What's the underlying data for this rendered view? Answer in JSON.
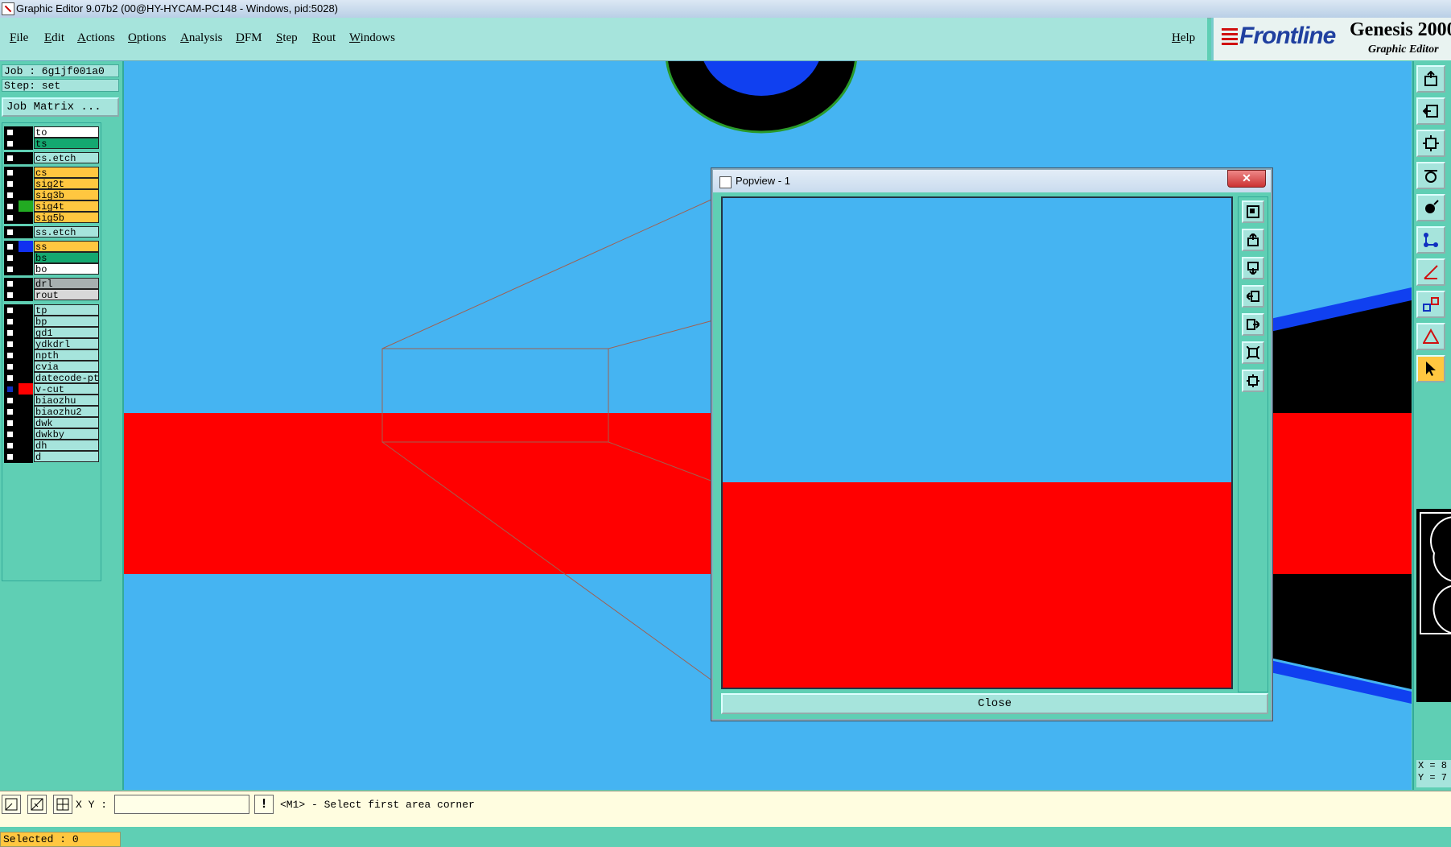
{
  "window": {
    "title": "Graphic Editor 9.07b2 (00@HY-HYCAM-PC148 - Windows, pid:5028)"
  },
  "menu": {
    "items": [
      "File",
      "Edit",
      "Actions",
      "Options",
      "Analysis",
      "DFM",
      "Step",
      "Rout",
      "Windows"
    ],
    "help": "Help"
  },
  "brand": {
    "logo": "Frontline",
    "product": "Genesis 2000",
    "subtitle": "Graphic Editor"
  },
  "info": {
    "job": "Job : 6g1jf001a0",
    "step": "Step: set",
    "job_matrix": "Job Matrix ..."
  },
  "layers": [
    {
      "name": "to",
      "color": "#ffffff",
      "swatch": "#000000",
      "checked": false
    },
    {
      "name": "ts",
      "color": "#14a870",
      "swatch": "#000000",
      "checked": false
    },
    {
      "name": "cs.etch",
      "color": "#a6e4dc",
      "swatch": "#000000",
      "checked": false
    },
    {
      "name": "cs",
      "color": "#ffc740",
      "swatch": "#000000",
      "checked": false
    },
    {
      "name": "sig2t",
      "color": "#ffc740",
      "swatch": "#000000",
      "checked": false
    },
    {
      "name": "sig3b",
      "color": "#ffc740",
      "swatch": "#000000",
      "checked": false
    },
    {
      "name": "sig4t",
      "color": "#ffc740",
      "swatch": "#22aa22",
      "checked": false
    },
    {
      "name": "sig5b",
      "color": "#ffc740",
      "swatch": "#000000",
      "checked": false
    },
    {
      "name": "ss.etch",
      "color": "#a6e4dc",
      "swatch": "#000000",
      "checked": false
    },
    {
      "name": "ss",
      "color": "#ffc740",
      "swatch": "#1030f0",
      "checked": false
    },
    {
      "name": "bs",
      "color": "#14a870",
      "swatch": "#000000",
      "checked": false
    },
    {
      "name": "bo",
      "color": "#ffffff",
      "swatch": "#000000",
      "checked": false
    },
    {
      "name": "drl",
      "color": "#a8b0b0",
      "swatch": "#000000",
      "checked": false
    },
    {
      "name": "rout",
      "color": "#d8d8d8",
      "swatch": "#000000",
      "checked": false
    },
    {
      "name": "tp",
      "color": "#a6e4dc",
      "swatch": "#000000",
      "checked": false
    },
    {
      "name": "bp",
      "color": "#a6e4dc",
      "swatch": "#000000",
      "checked": false
    },
    {
      "name": "gd1",
      "color": "#a6e4dc",
      "swatch": "#000000",
      "checked": false
    },
    {
      "name": "ydkdrl",
      "color": "#a6e4dc",
      "swatch": "#000000",
      "checked": false
    },
    {
      "name": "npth",
      "color": "#a6e4dc",
      "swatch": "#000000",
      "checked": false
    },
    {
      "name": "cvia",
      "color": "#a6e4dc",
      "swatch": "#000000",
      "checked": false
    },
    {
      "name": "datecode-pt",
      "color": "#a6e4dc",
      "swatch": "#000000",
      "checked": false
    },
    {
      "name": "v-cut",
      "color": "#a6e4dc",
      "swatch": "#ff0000",
      "checked": true
    },
    {
      "name": "biaozhu",
      "color": "#a6e4dc",
      "swatch": "#000000",
      "checked": false
    },
    {
      "name": "biaozhu2",
      "color": "#a6e4dc",
      "swatch": "#000000",
      "checked": false
    },
    {
      "name": "dwk",
      "color": "#a6e4dc",
      "swatch": "#000000",
      "checked": false
    },
    {
      "name": "dwkby",
      "color": "#a6e4dc",
      "swatch": "#000000",
      "checked": false
    },
    {
      "name": "dh",
      "color": "#a6e4dc",
      "swatch": "#000000",
      "checked": false
    },
    {
      "name": "d",
      "color": "#a6e4dc",
      "swatch": "#000000",
      "checked": false
    }
  ],
  "selected": "Selected : 0",
  "popview": {
    "title": "Popview - 1",
    "close_x": "✕",
    "close_label": "Close"
  },
  "status": {
    "xy_label": "X Y :",
    "xy_value": "",
    "message": "<M1> - Select first area corner",
    "alert_icon": "!"
  },
  "coords": {
    "x": "X = 8",
    "y": "Y = 7"
  },
  "colors": {
    "canvas": "#45b4f2",
    "vcut": "#ff0000",
    "panel": "#5fcfb4",
    "accent_yellow": "#ffc740"
  }
}
